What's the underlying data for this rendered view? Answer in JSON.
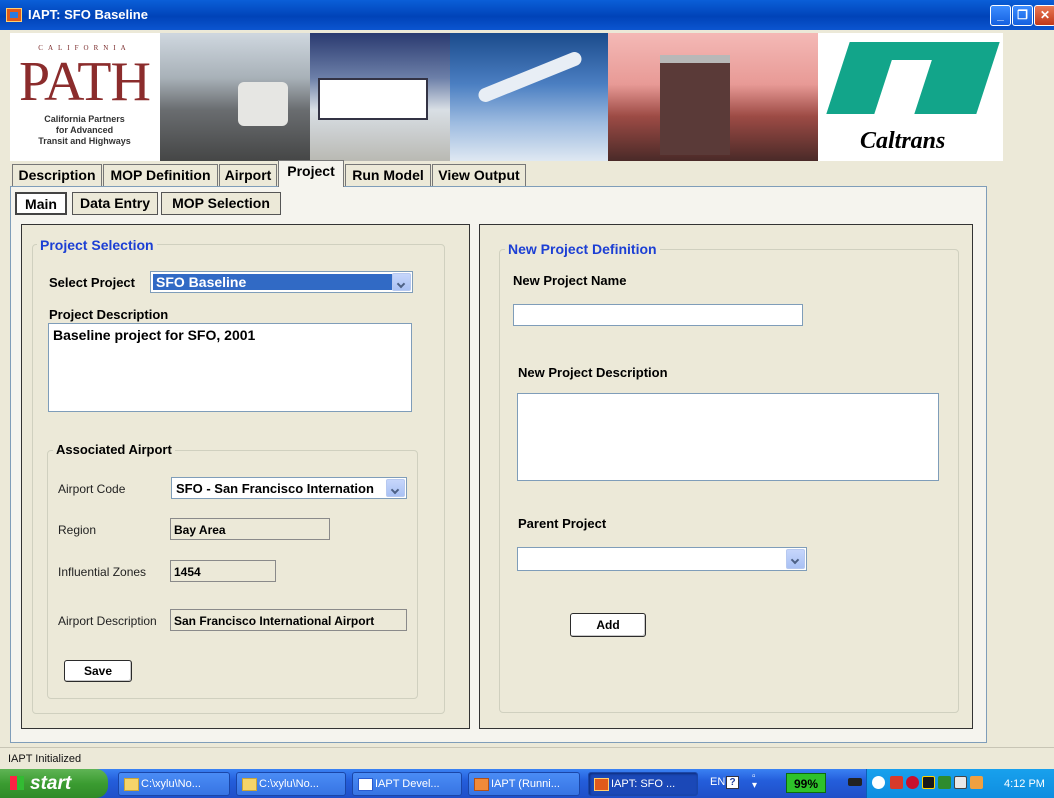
{
  "window": {
    "title": "IAPT: SFO Baseline"
  },
  "banner": {
    "path_small": "CALIFORNIA",
    "path_big": "PATH",
    "path_subtitle": "California Partners\nfor Advanced\nTransit and Highways",
    "caltrans_word": "Caltrans"
  },
  "main_tabs": [
    "Description",
    "MOP Definition",
    "Airport",
    "Project",
    "Run Model",
    "View Output"
  ],
  "active_main_tab": "Project",
  "sub_tabs": [
    "Main",
    "Data Entry",
    "MOP Selection"
  ],
  "active_sub_tab": "Main",
  "project_selection": {
    "title": "Project Selection",
    "select_label": "Select Project",
    "selected_project": "SFO Baseline",
    "description_label": "Project Description",
    "description_value": "Baseline project for SFO, 2001",
    "airport": {
      "title": "Associated Airport",
      "code_label": "Airport Code",
      "code_value": "SFO - San Francisco Internation",
      "region_label": "Region",
      "region_value": "Bay Area",
      "zones_label": "Influential Zones",
      "zones_value": "1454",
      "desc_label": "Airport Description",
      "desc_value": "San Francisco International Airport"
    },
    "save_label": "Save"
  },
  "new_project": {
    "title": "New Project Definition",
    "name_label": "New Project Name",
    "name_value": "",
    "desc_label": "New Project Description",
    "desc_value": "",
    "parent_label": "Parent Project",
    "parent_value": "",
    "add_label": "Add"
  },
  "status": {
    "text": "IAPT Initialized"
  },
  "taskbar": {
    "start_label": "start",
    "tasks": [
      "C:\\xylu\\No...",
      "C:\\xylu\\No...",
      "IAPT Devel...",
      "IAPT (Runni...",
      "IAPT: SFO ..."
    ],
    "lang": "EN",
    "battery": "99%",
    "clock": "4:12 PM"
  },
  "colors": {
    "title_bar": "#0a5fd8",
    "group_title": "#1c3fd4",
    "selection": "#316ac5",
    "taskbar": "#245edb",
    "start": "#3b9c31"
  }
}
